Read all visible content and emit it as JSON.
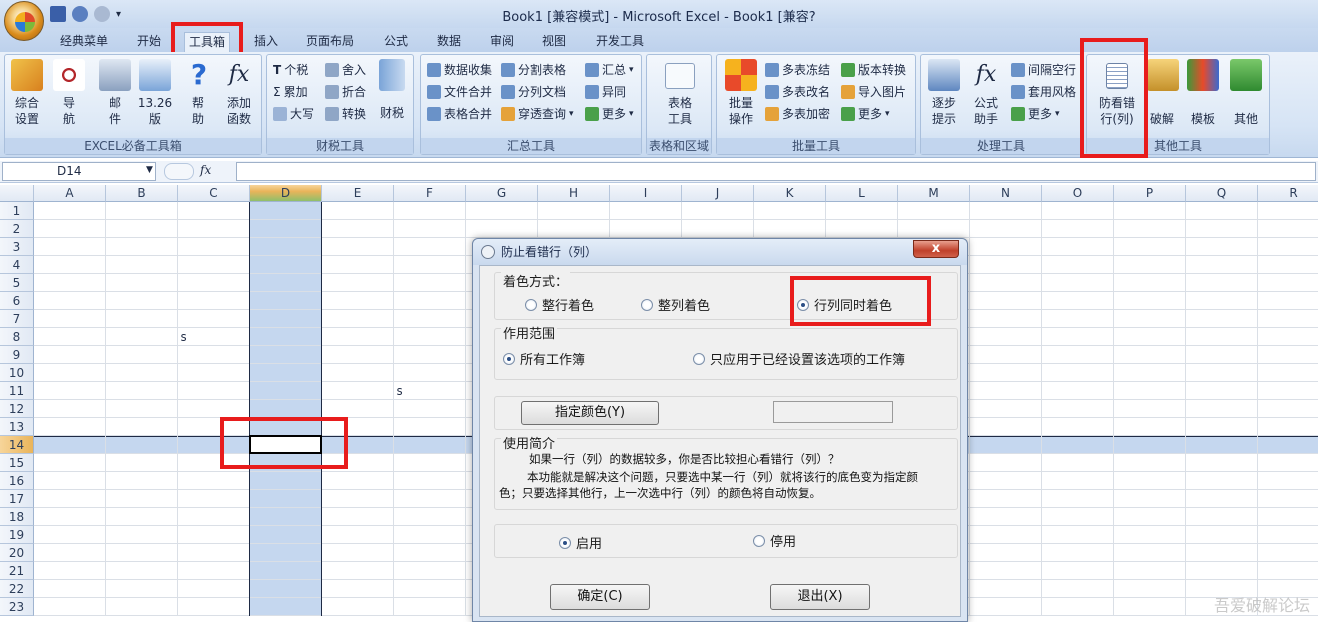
{
  "title": "Book1  [兼容模式] - Microsoft Excel - Book1  [兼容?",
  "tabs": [
    "经典菜单",
    "开始",
    "工具箱",
    "插入",
    "页面布局",
    "公式",
    "数据",
    "审阅",
    "视图",
    "开发工具"
  ],
  "active_tab": "工具箱",
  "ribbon": {
    "g1": {
      "label": "EXCEL必备工具箱",
      "b1": "综合\n设置",
      "b2": "导\n航",
      "b3": "邮\n件",
      "b4": "13.26\n版",
      "b5": "帮\n助",
      "b6": "添加\n函数"
    },
    "g2": {
      "label": "财税工具",
      "s1": "个税",
      "s2": "累加",
      "s3": "大写",
      "s4": "舍入",
      "s5": "折合",
      "s6": "转换",
      "b": "财税"
    },
    "g3": {
      "label": "汇总工具",
      "s1": "数据收集",
      "s2": "文件合并",
      "s3": "表格合并",
      "s4": "分割表格",
      "s5": "分列文档",
      "s6": "穿透查询",
      "s7": "汇总",
      "s8": "异同",
      "s9": "更多"
    },
    "g4": {
      "label": "表格和区域",
      "b": "表格\n工具"
    },
    "g5": {
      "label": "批量工具",
      "b": "批量\n操作",
      "s1": "多表冻结",
      "s2": "多表改名",
      "s3": "多表加密",
      "s4": "版本转换",
      "s5": "导入图片",
      "s6": "更多"
    },
    "g6": {
      "label": "处理工具",
      "b1": "逐步\n提示",
      "b2": "公式\n助手",
      "s1": "间隔空行",
      "s2": "套用风格",
      "s3": "更多"
    },
    "g7": {
      "label": "其他工具",
      "b1": "防看错\n行(列)",
      "b2": "破解",
      "b3": "模板",
      "b4": "其他"
    }
  },
  "namebox": "D14",
  "fx": "fx",
  "columns": [
    "A",
    "B",
    "C",
    "D",
    "E",
    "F",
    "G",
    "H",
    "I",
    "J",
    "K",
    "L",
    "M",
    "N",
    "O",
    "P",
    "Q",
    "R"
  ],
  "rows": [
    "1",
    "2",
    "3",
    "4",
    "5",
    "6",
    "7",
    "8",
    "9",
    "10",
    "11",
    "12",
    "13",
    "14",
    "15",
    "16",
    "17",
    "18",
    "19",
    "20",
    "21",
    "22",
    "23"
  ],
  "cells": {
    "c8": "s",
    "f11": "s"
  },
  "dialog": {
    "title": "防止看错行（列）",
    "close": "x",
    "color_mode_label": "着色方式：",
    "opt_row": "整行着色",
    "opt_col": "整列着色",
    "opt_both": "行列同时着色",
    "scope_label": "作用范围",
    "scope_all": "所有工作簿",
    "scope_set": "只应用于已经设置该选项的工作簿",
    "color_btn": "指定颜色(Y)",
    "intro_label": "使用简介",
    "intro1": "如果一行（列）的数据较多，你是否比较担心看错行（列）？",
    "intro2": "本功能就是解决这个问题，只要选中某一行（列）就将该行的底色变为指定颜色；只要选择其他行，上一次选中行（列）的颜色将自动恢复。",
    "enable": "启用",
    "disable": "停用",
    "ok": "确定(C)",
    "exit": "退出(X)"
  },
  "watermark": "吾爱破解论坛"
}
